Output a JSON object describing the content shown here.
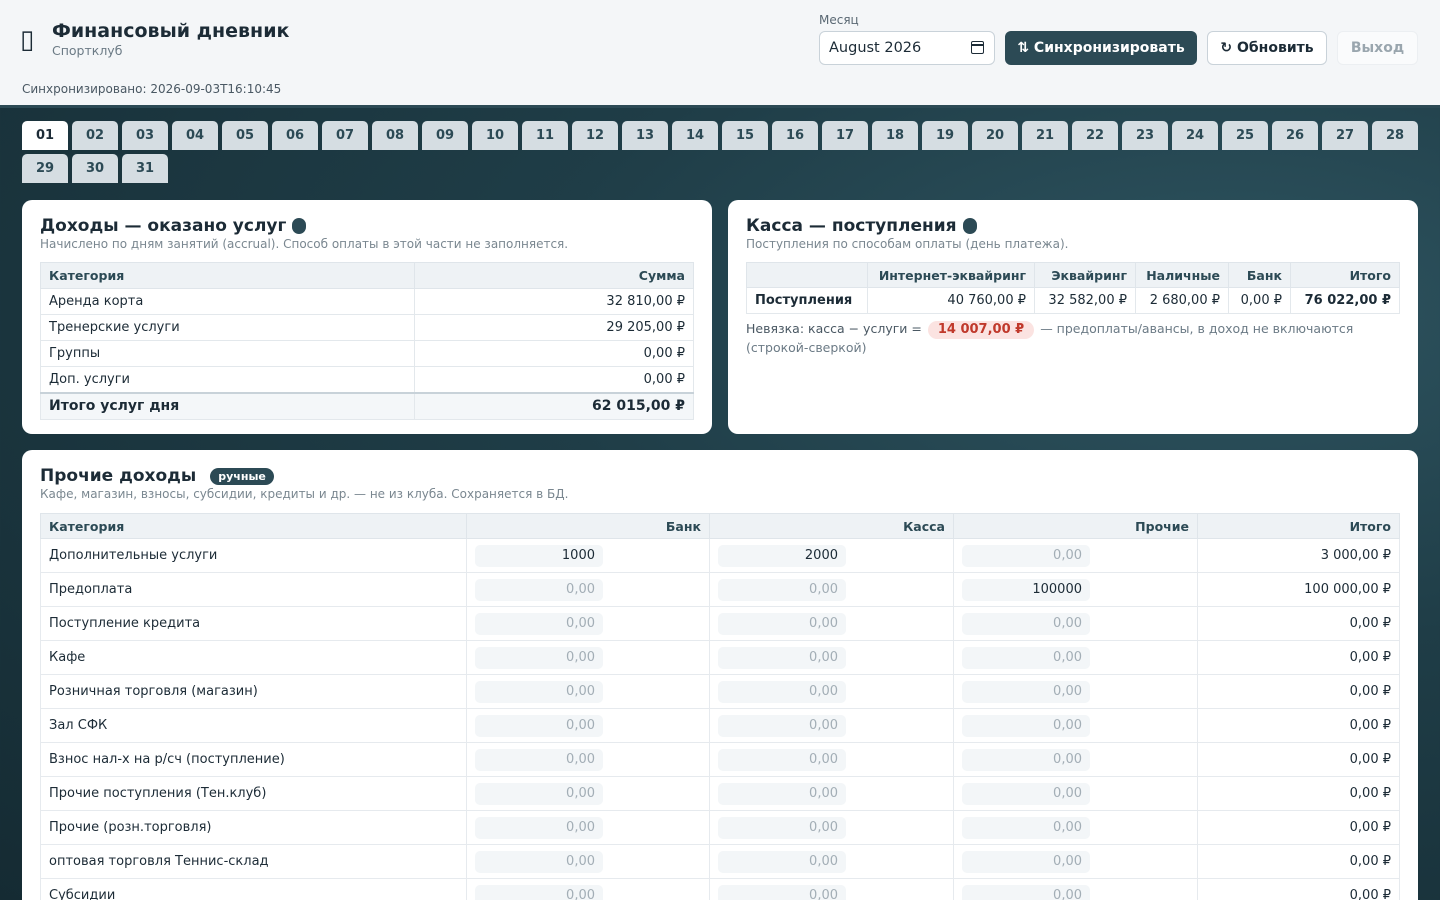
{
  "header": {
    "icon": "wallet-icon",
    "title": "Финансовый дневник",
    "subtitle": "Спортклуб",
    "sync_status": "Синхронизировано: 2026-09-03T16:10:45",
    "month_label": "Месяц",
    "month_value": "August 2026",
    "sync_button": "⇅ Синхронизировать",
    "refresh_button": "↻ Обновить",
    "logout_button": "Выход"
  },
  "days": {
    "active": "01",
    "items": [
      "01",
      "02",
      "03",
      "04",
      "05",
      "06",
      "07",
      "08",
      "09",
      "10",
      "11",
      "12",
      "13",
      "14",
      "15",
      "16",
      "17",
      "18",
      "19",
      "20",
      "21",
      "22",
      "23",
      "24",
      "25",
      "26",
      "27",
      "28",
      "29",
      "30",
      "31"
    ]
  },
  "services": {
    "title": "Доходы — оказано услуг",
    "subtitle": "Начислено по дням занятий (accrual). Способ оплаты в этой части не заполняется.",
    "col_category": "Категория",
    "col_sum": "Сумма",
    "rows": [
      {
        "category": "Аренда корта",
        "sum": "32 810,00 ₽"
      },
      {
        "category": "Тренерские услуги",
        "sum": "29 205,00 ₽"
      },
      {
        "category": "Группы",
        "sum": "0,00 ₽"
      },
      {
        "category": "Доп. услуги",
        "sum": "0,00 ₽"
      }
    ],
    "total_label": "Итого услуг дня",
    "total_value": "62 015,00 ₽"
  },
  "cash": {
    "title": "Касса — поступления",
    "subtitle": "Поступления по способам оплаты (день платежа).",
    "columns": [
      "",
      "Интернет-эквайринг",
      "Эквайринг",
      "Наличные",
      "Банк",
      "Итого"
    ],
    "row_label": "Поступления",
    "values": [
      "40 760,00 ₽",
      "32 582,00 ₽",
      "2 680,00 ₽",
      "0,00 ₽",
      "76 022,00 ₽"
    ],
    "discrepancy_label": "Невязка: касса − услуги =",
    "discrepancy_value": "14 007,00 ₽",
    "discrepancy_note": "— предоплаты/авансы, в доход не включаются (строкой-сверкой)"
  },
  "other": {
    "title": "Прочие доходы",
    "badge": "ручные",
    "subtitle": "Кафе, магазин, взносы, субсидии, кредиты и др. — не из клуба. Сохраняется в БД.",
    "columns": [
      "Категория",
      "Банк",
      "Касса",
      "Прочие",
      "Итого"
    ],
    "rows": [
      {
        "category": "Дополнительные услуги",
        "bank": "1000",
        "cash": "2000",
        "other": "0,00",
        "total": "3 000,00 ₽"
      },
      {
        "category": "Предоплата",
        "bank": "0,00",
        "cash": "0,00",
        "other": "100000",
        "total": "100 000,00 ₽"
      },
      {
        "category": "Поступление кредита",
        "bank": "0,00",
        "cash": "0,00",
        "other": "0,00",
        "total": "0,00 ₽"
      },
      {
        "category": "Кафе",
        "bank": "0,00",
        "cash": "0,00",
        "other": "0,00",
        "total": "0,00 ₽"
      },
      {
        "category": "Розничная торговля (магазин)",
        "bank": "0,00",
        "cash": "0,00",
        "other": "0,00",
        "total": "0,00 ₽"
      },
      {
        "category": "Зал СФК",
        "bank": "0,00",
        "cash": "0,00",
        "other": "0,00",
        "total": "0,00 ₽"
      },
      {
        "category": "Взнос нал-х на р/сч (поступление)",
        "bank": "0,00",
        "cash": "0,00",
        "other": "0,00",
        "total": "0,00 ₽"
      },
      {
        "category": "Прочие поступления (Тен.клуб)",
        "bank": "0,00",
        "cash": "0,00",
        "other": "0,00",
        "total": "0,00 ₽"
      },
      {
        "category": "Прочие (розн.торговля)",
        "bank": "0,00",
        "cash": "0,00",
        "other": "0,00",
        "total": "0,00 ₽"
      },
      {
        "category": "оптовая торговля Теннис-склад",
        "bank": "0,00",
        "cash": "0,00",
        "other": "0,00",
        "total": "0,00 ₽"
      },
      {
        "category": "Субсидии",
        "bank": "0,00",
        "cash": "0,00",
        "other": "0,00",
        "total": "0,00 ₽"
      }
    ]
  }
}
